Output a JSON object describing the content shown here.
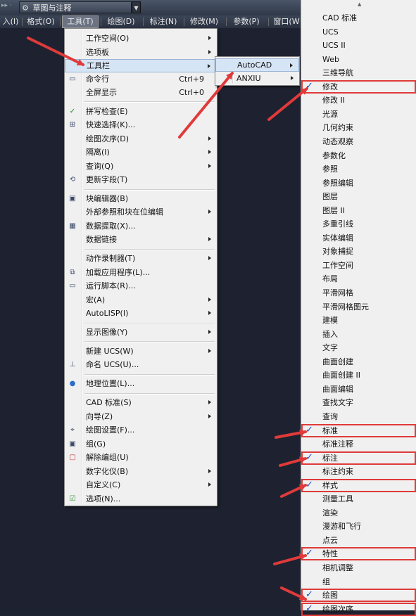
{
  "workspace": {
    "name": "草图与注释",
    "left_marker": "▸▸ ·"
  },
  "menubar": [
    {
      "label": "入(I)"
    },
    {
      "label": "格式(O)"
    },
    {
      "label": "工具(T)"
    },
    {
      "label": "绘图(D)"
    },
    {
      "label": "标注(N)"
    },
    {
      "label": "修改(M)"
    },
    {
      "label": "参数(P)"
    },
    {
      "label": "窗口(W"
    }
  ],
  "tools_menu": [
    {
      "label": "工作空间(O)",
      "submenu": true
    },
    {
      "label": "选项板",
      "submenu": true
    },
    {
      "label": "工具栏",
      "submenu": true,
      "highlighted": true
    },
    {
      "label": "命令行",
      "shortcut": "Ctrl+9",
      "icon": "command-line-icon"
    },
    {
      "label": "全屏显示",
      "shortcut": "Ctrl+0"
    },
    {
      "label": "拼写检查(E)",
      "icon": "spell-check-icon"
    },
    {
      "label": "快速选择(K)...",
      "icon": "quick-select-icon"
    },
    {
      "label": "绘图次序(D)",
      "submenu": true
    },
    {
      "label": "隔离(I)",
      "submenu": true
    },
    {
      "label": "查询(Q)",
      "submenu": true
    },
    {
      "label": "更新字段(T)",
      "icon": "update-field-icon"
    },
    {
      "label": "块编辑器(B)",
      "icon": "block-editor-icon"
    },
    {
      "label": "外部参照和块在位编辑",
      "submenu": true
    },
    {
      "label": "数据提取(X)...",
      "icon": "data-extract-icon"
    },
    {
      "label": "数据链接",
      "submenu": true
    },
    {
      "label": "动作录制器(T)",
      "submenu": true
    },
    {
      "label": "加载应用程序(L)...",
      "icon": "load-app-icon"
    },
    {
      "label": "运行脚本(R)...",
      "icon": "run-script-icon"
    },
    {
      "label": "宏(A)",
      "submenu": true
    },
    {
      "label": "AutoLISP(I)",
      "submenu": true
    },
    {
      "label": "显示图像(Y)",
      "submenu": true
    },
    {
      "label": "新建 UCS(W)",
      "submenu": true
    },
    {
      "label": "命名 UCS(U)...",
      "icon": "named-ucs-icon"
    },
    {
      "label": "地理位置(L)...",
      "icon": "globe-icon"
    },
    {
      "label": "CAD 标准(S)",
      "submenu": true
    },
    {
      "label": "向导(Z)",
      "submenu": true
    },
    {
      "label": "绘图设置(F)...",
      "icon": "drafting-settings-icon"
    },
    {
      "label": "组(G)",
      "icon": "group-icon"
    },
    {
      "label": "解除编组(U)",
      "icon": "ungroup-icon"
    },
    {
      "label": "数字化仪(B)",
      "submenu": true
    },
    {
      "label": "自定义(C)",
      "submenu": true
    },
    {
      "label": "选项(N)...",
      "icon": "options-icon"
    }
  ],
  "toolbar_submenu": [
    {
      "label": "AutoCAD",
      "highlighted": true
    },
    {
      "label": "ANXIU"
    }
  ],
  "toolbar_list": {
    "scroll_up": "▲",
    "check_mark": "✓",
    "items": [
      {
        "label": "CAD 标准",
        "checked": false
      },
      {
        "label": "UCS",
        "checked": false
      },
      {
        "label": "UCS II",
        "checked": false
      },
      {
        "label": "Web",
        "checked": false
      },
      {
        "label": "三维导航",
        "checked": false
      },
      {
        "label": "修改",
        "checked": true
      },
      {
        "label": "修改 II",
        "checked": false
      },
      {
        "label": "光源",
        "checked": false
      },
      {
        "label": "几何约束",
        "checked": false
      },
      {
        "label": "动态观察",
        "checked": false
      },
      {
        "label": "参数化",
        "checked": false
      },
      {
        "label": "参照",
        "checked": false
      },
      {
        "label": "参照编辑",
        "checked": false
      },
      {
        "label": "图层",
        "checked": false
      },
      {
        "label": "图层 II",
        "checked": false
      },
      {
        "label": "多重引线",
        "checked": false
      },
      {
        "label": "实体编辑",
        "checked": false
      },
      {
        "label": "对象捕捉",
        "checked": false
      },
      {
        "label": "工作空间",
        "checked": false
      },
      {
        "label": "布局",
        "checked": false
      },
      {
        "label": "平滑网格",
        "checked": false
      },
      {
        "label": "平滑网格图元",
        "checked": false
      },
      {
        "label": "建模",
        "checked": false
      },
      {
        "label": "插入",
        "checked": false
      },
      {
        "label": "文字",
        "checked": false
      },
      {
        "label": "曲面创建",
        "checked": false
      },
      {
        "label": "曲面创建 II",
        "checked": false
      },
      {
        "label": "曲面编辑",
        "checked": false
      },
      {
        "label": "查找文字",
        "checked": false
      },
      {
        "label": "查询",
        "checked": false
      },
      {
        "label": "标准",
        "checked": true
      },
      {
        "label": "标准注释",
        "checked": false
      },
      {
        "label": "标注",
        "checked": true
      },
      {
        "label": "标注约束",
        "checked": false
      },
      {
        "label": "样式",
        "checked": true
      },
      {
        "label": "测量工具",
        "checked": false
      },
      {
        "label": "渲染",
        "checked": false
      },
      {
        "label": "漫游和飞行",
        "checked": false
      },
      {
        "label": "点云",
        "checked": false
      },
      {
        "label": "特性",
        "checked": true
      },
      {
        "label": "相机调整",
        "checked": false
      },
      {
        "label": "组",
        "checked": false
      },
      {
        "label": "绘图",
        "checked": true
      },
      {
        "label": "绘图次序",
        "checked": true
      }
    ]
  },
  "colors": {
    "annotation_red": "#e03a3a",
    "check_blue": "#1a4fd0",
    "highlight": "#d6e5f5"
  }
}
